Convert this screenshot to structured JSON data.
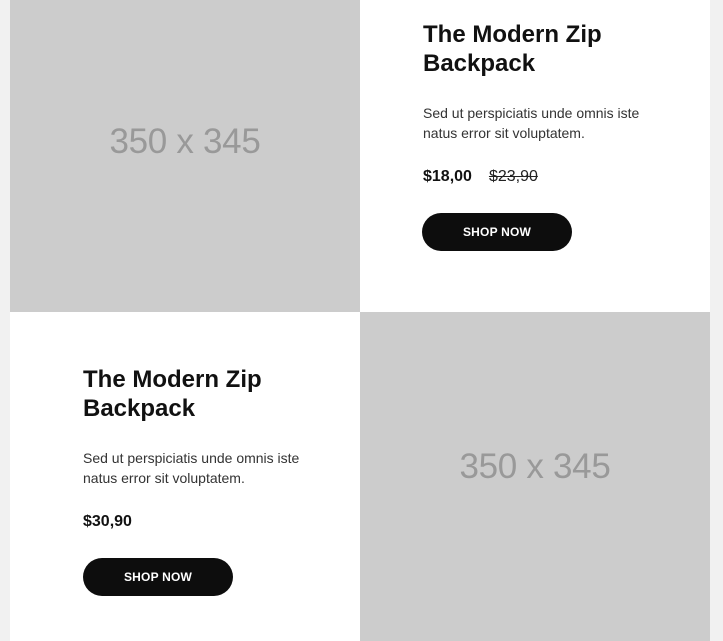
{
  "products": [
    {
      "image_placeholder": "350 x 345",
      "title": "The Modern Zip Backpack",
      "description": "Sed ut perspiciatis unde omnis iste natus error sit voluptatem.",
      "price": "$18,00",
      "old_price": "$23,90",
      "button_label": "SHOP NOW"
    },
    {
      "image_placeholder": "350 x 345",
      "title": "The Modern Zip Backpack",
      "description": "Sed ut perspiciatis unde omnis iste natus error sit voluptatem.",
      "price": "$30,90",
      "button_label": "SHOP NOW"
    }
  ],
  "colors": {
    "page_background": "#f1f1f1",
    "card_background": "#ffffff",
    "placeholder_background": "#cccccc",
    "placeholder_text": "#999999",
    "button_background": "#0d0d0d",
    "button_text": "#ffffff"
  }
}
